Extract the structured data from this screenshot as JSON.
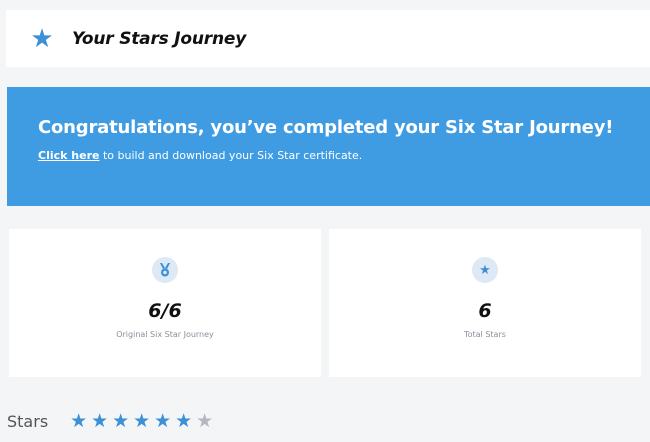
{
  "header": {
    "icon": "star-icon",
    "title": "Your Stars Journey"
  },
  "banner": {
    "headline": "Congratulations, you’ve completed your Six Star Journey!",
    "link_text": "Click here",
    "sub_text": " to build and download your Six Star certificate.",
    "background": "#409ce2"
  },
  "cards": [
    {
      "icon": "medal-icon",
      "value": "6/6",
      "label": "Original Six Star Journey"
    },
    {
      "icon": "star-icon",
      "value": "6",
      "label": "Total Stars"
    }
  ],
  "stars": {
    "label": "Stars",
    "filled": 6,
    "total": 7
  },
  "colors": {
    "accent": "#3d8fd6",
    "star_empty": "#b3b8c0"
  }
}
